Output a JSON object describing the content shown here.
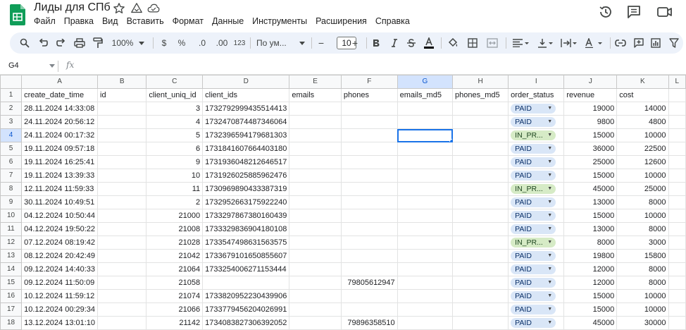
{
  "title": "Лиды для СПб",
  "menu": [
    "Файл",
    "Правка",
    "Вид",
    "Вставить",
    "Формат",
    "Данные",
    "Инструменты",
    "Расширения",
    "Справка"
  ],
  "toolbar": {
    "zoom": "100%",
    "currency": "$",
    "percent": "%",
    "dec_dec": ".0",
    "dec_inc": ".00",
    "number_format": "123",
    "font": "По ум...",
    "font_size": "10",
    "minus": "−",
    "plus": "+"
  },
  "namebox": "G4",
  "fx": "fx",
  "colors": {
    "accent": "#1a73e8",
    "chip_paid": "#d9e6f7",
    "chip_inprogress": "#d6ebc6"
  },
  "column_letters": [
    "A",
    "B",
    "C",
    "D",
    "E",
    "F",
    "G",
    "H",
    "I",
    "J",
    "K",
    "L"
  ],
  "header_row": {
    "num": "1",
    "cells": [
      "create_date_time",
      "id",
      "client_uniq_id",
      "client_ids",
      "emails",
      "phones",
      "emails_md5",
      "phones_md5",
      "order_status",
      "revenue",
      "cost",
      ""
    ]
  },
  "rows": [
    {
      "num": "2",
      "date": "28.11.2024 14:33:08",
      "client_uniq_id": "3",
      "client_ids": "1732792999435514413",
      "phones": "",
      "status": "PAID",
      "revenue": "19000",
      "cost": "14000"
    },
    {
      "num": "3",
      "date": "24.11.2024 20:56:12",
      "client_uniq_id": "4",
      "client_ids": "1732470874487346064",
      "phones": "",
      "status": "PAID",
      "revenue": "9800",
      "cost": "4800"
    },
    {
      "num": "4",
      "date": "24.11.2024 00:17:32",
      "client_uniq_id": "5",
      "client_ids": "1732396594179681303",
      "phones": "",
      "status": "IN_PR...",
      "revenue": "15000",
      "cost": "10000"
    },
    {
      "num": "5",
      "date": "19.11.2024 09:57:18",
      "client_uniq_id": "6",
      "client_ids": "1731841607664403180",
      "phones": "",
      "status": "PAID",
      "revenue": "36000",
      "cost": "22500"
    },
    {
      "num": "6",
      "date": "19.11.2024 16:25:41",
      "client_uniq_id": "9",
      "client_ids": "1731936048212646517",
      "phones": "",
      "status": "PAID",
      "revenue": "25000",
      "cost": "12600"
    },
    {
      "num": "7",
      "date": "19.11.2024 13:39:33",
      "client_uniq_id": "10",
      "client_ids": "1731926025885962476",
      "phones": "",
      "status": "PAID",
      "revenue": "15000",
      "cost": "10000"
    },
    {
      "num": "8",
      "date": "12.11.2024 11:59:33",
      "client_uniq_id": "11",
      "client_ids": "1730969890433387319",
      "phones": "",
      "status": "IN_PR...",
      "revenue": "45000",
      "cost": "25000"
    },
    {
      "num": "9",
      "date": "30.11.2024 10:49:51",
      "client_uniq_id": "2",
      "client_ids": "1732952663175922240",
      "phones": "",
      "status": "PAID",
      "revenue": "13000",
      "cost": "8000"
    },
    {
      "num": "10",
      "date": "04.12.2024 10:50:44",
      "client_uniq_id": "21000",
      "client_ids": "1733297867380160439",
      "phones": "",
      "status": "PAID",
      "revenue": "15000",
      "cost": "10000"
    },
    {
      "num": "11",
      "date": "04.12.2024 19:50:22",
      "client_uniq_id": "21008",
      "client_ids": "1733329836904180108",
      "phones": "",
      "status": "PAID",
      "revenue": "13000",
      "cost": "8000"
    },
    {
      "num": "12",
      "date": "07.12.2024 08:19:42",
      "client_uniq_id": "21028",
      "client_ids": "1733547498631563575",
      "phones": "",
      "status": "IN_PR...",
      "revenue": "8000",
      "cost": "3000"
    },
    {
      "num": "13",
      "date": "08.12.2024 20:42:49",
      "client_uniq_id": "21042",
      "client_ids": "1733679101650855607",
      "phones": "",
      "status": "PAID",
      "revenue": "19800",
      "cost": "15800"
    },
    {
      "num": "14",
      "date": "09.12.2024 14:40:33",
      "client_uniq_id": "21064",
      "client_ids": "1733254006271153444",
      "phones": "",
      "status": "PAID",
      "revenue": "12000",
      "cost": "8000"
    },
    {
      "num": "15",
      "date": "09.12.2024 11:50:09",
      "client_uniq_id": "21058",
      "client_ids": "",
      "phones": "79805612947",
      "status": "PAID",
      "revenue": "12000",
      "cost": "8000"
    },
    {
      "num": "16",
      "date": "10.12.2024 11:59:12",
      "client_uniq_id": "21074",
      "client_ids": "1733820952230439906",
      "phones": "",
      "status": "PAID",
      "revenue": "15000",
      "cost": "10000"
    },
    {
      "num": "17",
      "date": "10.12.2024 00:29:34",
      "client_uniq_id": "21066",
      "client_ids": "1733779456204026991",
      "phones": "",
      "status": "PAID",
      "revenue": "15000",
      "cost": "10000"
    },
    {
      "num": "18",
      "date": "13.12.2024 13:01:10",
      "client_uniq_id": "21142",
      "client_ids": "1734083827306392052",
      "phones": "79896358510",
      "status": "PAID",
      "revenue": "45000",
      "cost": "30000"
    }
  ]
}
